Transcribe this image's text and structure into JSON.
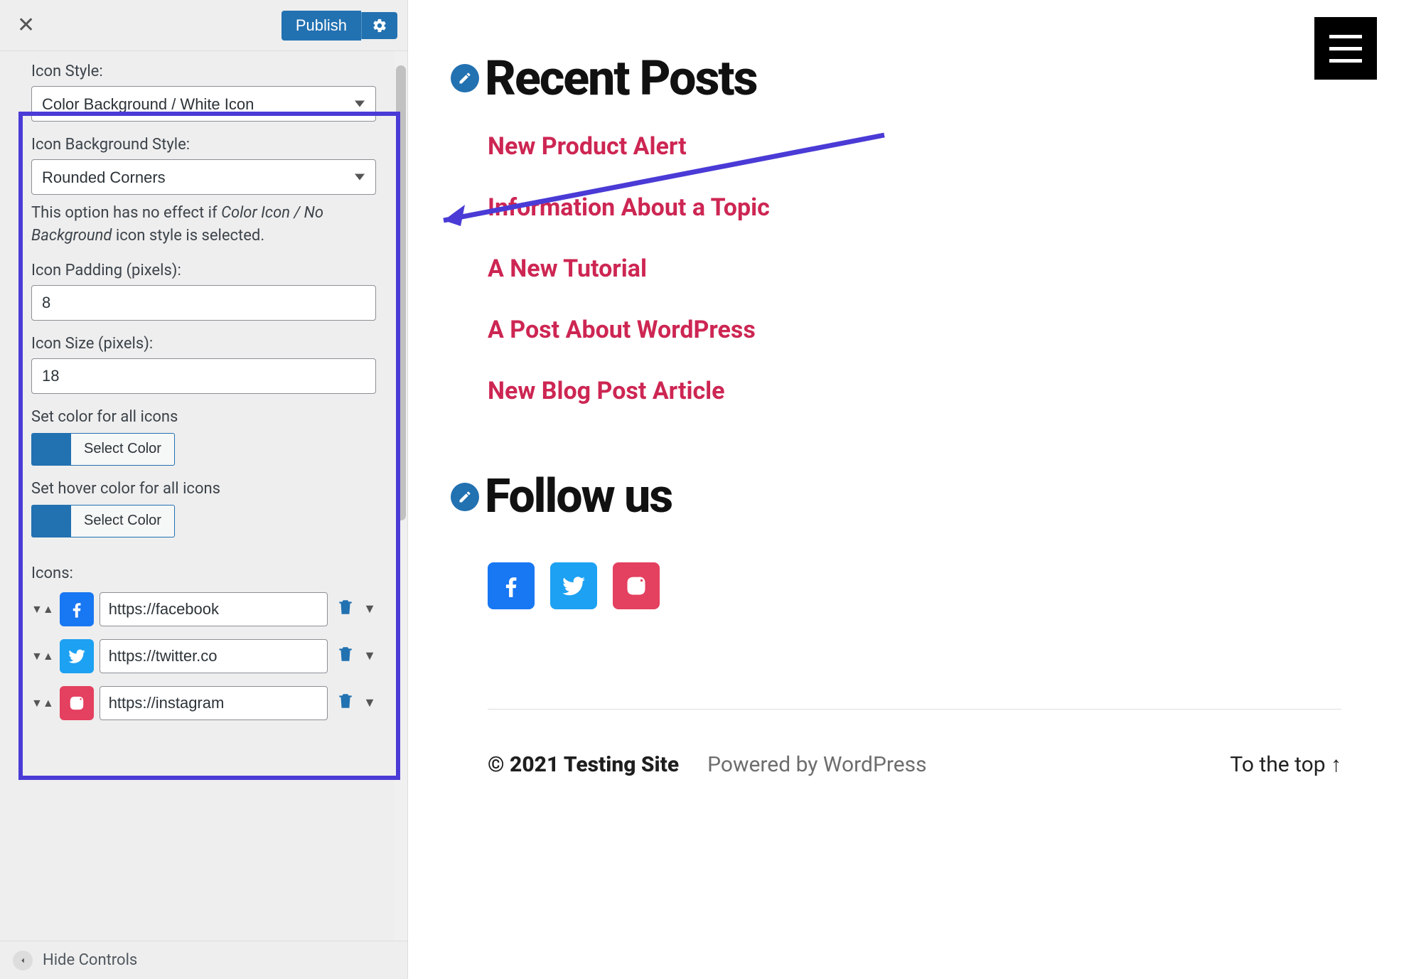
{
  "header": {
    "publish_label": "Publish"
  },
  "panel": {
    "icon_style_label": "Icon Style:",
    "icon_style_value": "Color Background / White Icon",
    "icon_bg_label": "Icon Background Style:",
    "icon_bg_value": "Rounded Corners",
    "help_prefix": "This option has no effect if ",
    "help_em": "Color Icon / No Background",
    "help_suffix": " icon style is selected.",
    "icon_padding_label": "Icon Padding (pixels):",
    "icon_padding_value": "8",
    "icon_size_label": "Icon Size (pixels):",
    "icon_size_value": "18",
    "set_color_label": "Set color for all icons",
    "select_color_label": "Select Color",
    "set_hover_label": "Set hover color for all icons",
    "icons_label": "Icons:",
    "icons": [
      {
        "network": "facebook",
        "url": "https://facebook"
      },
      {
        "network": "twitter",
        "url": "https://twitter.co"
      },
      {
        "network": "instagram",
        "url": "https://instagram"
      }
    ]
  },
  "footer_bar": {
    "hide_controls": "Hide Controls"
  },
  "preview": {
    "recent_heading": "Recent Posts",
    "posts": [
      "New Product Alert",
      "Information About a Topic",
      "A New Tutorial",
      "A Post About WordPress",
      "New Blog Post Article"
    ],
    "follow_heading": "Follow us",
    "footer_copyright": "© 2021 Testing Site",
    "footer_powered": "Powered by WordPress",
    "footer_top": "To the top ↑"
  }
}
